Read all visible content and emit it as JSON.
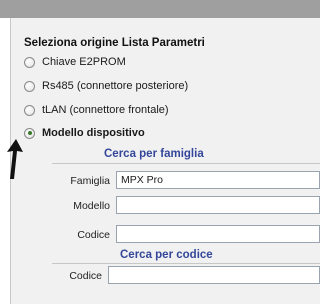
{
  "panel": {
    "title": "Seleziona origine Lista Parametri"
  },
  "source_options": [
    {
      "label": "Chiave E2PROM",
      "selected": false
    },
    {
      "label": "Rs485 (connettore posteriore)",
      "selected": false
    },
    {
      "label": "tLAN (connettore frontale)",
      "selected": false
    },
    {
      "label": "Modello dispositivo",
      "selected": true
    }
  ],
  "search_by_family": {
    "title": "Cerca per famiglia",
    "famiglia_label": "Famiglia",
    "famiglia_value": "MPX Pro",
    "modello_label": "Modello",
    "modello_value": "",
    "codice_label": "Codice",
    "codice_value": ""
  },
  "search_by_code": {
    "title": "Cerca per codice",
    "codice_label": "Codice",
    "codice_value": ""
  },
  "colors": {
    "section_title": "#34479a",
    "top_bar": "#9f9f9f",
    "panel_bg": "#f1f1f1"
  }
}
